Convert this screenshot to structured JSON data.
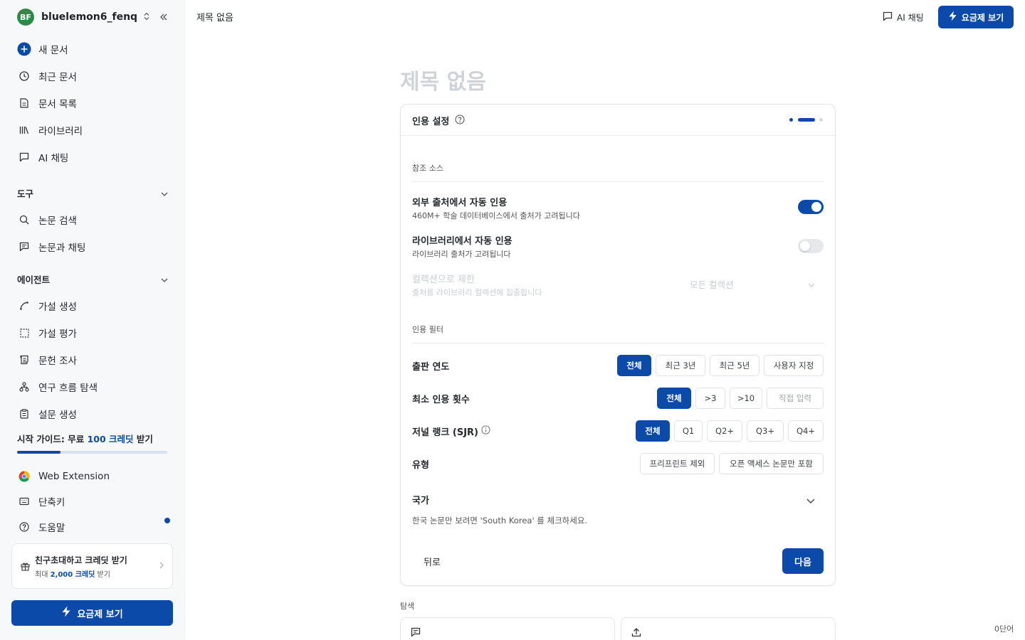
{
  "sidebar": {
    "workspace": {
      "initials": "BF",
      "name": "bluelemon6_fenq"
    },
    "main_nav": [
      {
        "label": "새 문서",
        "icon": "plus-circle-icon"
      },
      {
        "label": "최근 문서",
        "icon": "clock-icon"
      },
      {
        "label": "문서 목록",
        "icon": "document-icon"
      },
      {
        "label": "라이브러리",
        "icon": "library-icon"
      },
      {
        "label": "AI 채팅",
        "icon": "chat-icon"
      }
    ],
    "tools_section": "도구",
    "tools": [
      {
        "label": "논문 검색",
        "icon": "search-icon"
      },
      {
        "label": "논문과 채팅",
        "icon": "paper-chat-icon"
      }
    ],
    "agents_section": "에이전트",
    "agents": [
      {
        "label": "가설 생성",
        "icon": "curve-icon"
      },
      {
        "label": "가설 평가",
        "icon": "dashed-square-icon"
      },
      {
        "label": "문헌 조사",
        "icon": "scroll-icon"
      },
      {
        "label": "연구 흐름 탐색",
        "icon": "network-icon"
      },
      {
        "label": "설문 생성",
        "icon": "clipboard-icon"
      }
    ],
    "guide": {
      "prefix": "시작 가이드: 무료 ",
      "highlight": "100 크레딧",
      "suffix": " 받기",
      "progress": 0.29
    },
    "bottom": [
      {
        "label": "Web Extension",
        "icon": "chrome-icon"
      },
      {
        "label": "단축키",
        "icon": "keyboard-icon"
      },
      {
        "label": "도움말",
        "icon": "help-icon"
      }
    ],
    "invite": {
      "title": "친구초대하고 크레딧 받기",
      "sub_prefix": "최대 ",
      "sub_highlight": "2,000 크레딧",
      "sub_suffix": " 받기"
    },
    "upgrade_label": "요금제 보기"
  },
  "topbar": {
    "doc_title": "제목 없음",
    "ai_chat_label": "AI 채팅",
    "upgrade_label": "요금제 보기"
  },
  "editor": {
    "title_placeholder": "제목 없음"
  },
  "citation_card": {
    "title": "인용 설정",
    "step_current": 2,
    "step_total": 3,
    "source_section": "참조 소스",
    "options": [
      {
        "title": "외부 출처에서 자동 인용",
        "desc": "460M+ 학술 데이터베이스에서 출처가 고려됩니다",
        "enabled": true
      },
      {
        "title": "라이브러리에서 자동 인용",
        "desc": "라이브러리 출처가 고려됩니다",
        "enabled": false
      }
    ],
    "collection": {
      "title": "컬렉션으로 제한",
      "desc": "출처를 라이브러리 컬렉션에 집중합니다",
      "value": "모든 컬렉션"
    },
    "filter_section": "인용 필터",
    "filters": [
      {
        "label": "출판 연도",
        "options": [
          "전체",
          "최근 3년",
          "최근 5년",
          "사용자 지정"
        ]
      },
      {
        "label": "최소 인용 횟수",
        "options": [
          "전체",
          ">3",
          ">10",
          "직접 입력"
        ]
      },
      {
        "label": "저널 랭크 (SJR)",
        "options": [
          "전체",
          "Q1",
          "Q2+",
          "Q3+",
          "Q4+"
        ]
      },
      {
        "label": "유형",
        "options": [
          "프리프린트 제외",
          "오픈 액세스 논문만 포함"
        ]
      }
    ],
    "country": {
      "label": "국가",
      "hint": "한국 논문만 보려면 'South Korea' 를 체크하세요."
    },
    "back_label": "뒤로",
    "next_label": "다음"
  },
  "explore": {
    "label": "탐색"
  },
  "word_count": "0단어",
  "colors": {
    "accent": "#0b4aa8",
    "sidebar_bg": "#f7f8fa",
    "avatar": "#2f8a4a"
  }
}
